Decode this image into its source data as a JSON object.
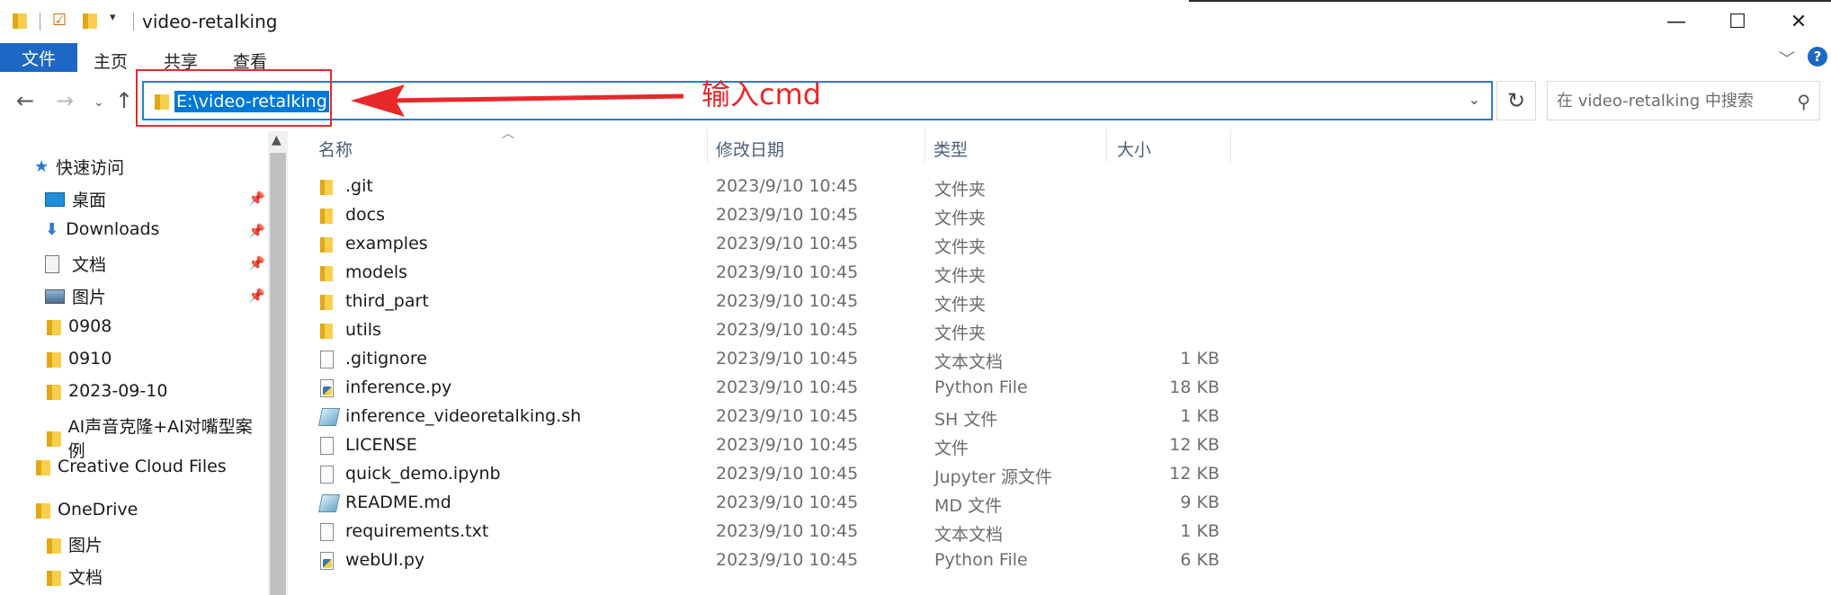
{
  "window": {
    "title": "video-retalking",
    "controls": {
      "minimize": "—",
      "maximize": "☐",
      "close": "✕"
    }
  },
  "ribbon": {
    "tabs": [
      "文件",
      "主页",
      "共享",
      "查看"
    ],
    "accent": "#1d68c4"
  },
  "address": {
    "path": "E:\\video-retalking",
    "search_placeholder": "在 video-retalking 中搜索"
  },
  "annotation": {
    "text": "输入cmd",
    "color": "#e8282b"
  },
  "nav": {
    "quick_access": "快速访问",
    "items": [
      {
        "label": "桌面",
        "icon": "desktop-icon",
        "pinned": true
      },
      {
        "label": "Downloads",
        "icon": "download-icon",
        "pinned": true
      },
      {
        "label": "文档",
        "icon": "document-icon",
        "pinned": true
      },
      {
        "label": "图片",
        "icon": "pictures-icon",
        "pinned": true
      },
      {
        "label": "0908",
        "icon": "folder-icon",
        "pinned": false
      },
      {
        "label": "0910",
        "icon": "folder-icon",
        "pinned": false
      },
      {
        "label": "2023-09-10",
        "icon": "folder-icon",
        "pinned": false
      },
      {
        "label": "AI声音克隆+AI对嘴型案例",
        "icon": "folder-icon",
        "pinned": false
      }
    ],
    "creative_cloud": "Creative Cloud Files",
    "onedrive": "OneDrive",
    "onedrive_items": [
      "图片",
      "文档"
    ]
  },
  "columns": {
    "name": "名称",
    "date": "修改日期",
    "type": "类型",
    "size": "大小"
  },
  "files": [
    {
      "name": ".git",
      "date": "2023/9/10 10:45",
      "type": "文件夹",
      "size": "",
      "kind": "folder"
    },
    {
      "name": "docs",
      "date": "2023/9/10 10:45",
      "type": "文件夹",
      "size": "",
      "kind": "folder"
    },
    {
      "name": "examples",
      "date": "2023/9/10 10:45",
      "type": "文件夹",
      "size": "",
      "kind": "folder"
    },
    {
      "name": "models",
      "date": "2023/9/10 10:45",
      "type": "文件夹",
      "size": "",
      "kind": "folder"
    },
    {
      "name": "third_part",
      "date": "2023/9/10 10:45",
      "type": "文件夹",
      "size": "",
      "kind": "folder"
    },
    {
      "name": "utils",
      "date": "2023/9/10 10:45",
      "type": "文件夹",
      "size": "",
      "kind": "folder"
    },
    {
      "name": ".gitignore",
      "date": "2023/9/10 10:45",
      "type": "文本文档",
      "size": "1 KB",
      "kind": "doc"
    },
    {
      "name": "inference.py",
      "date": "2023/9/10 10:45",
      "type": "Python File",
      "size": "18 KB",
      "kind": "py"
    },
    {
      "name": "inference_videoretalking.sh",
      "date": "2023/9/10 10:45",
      "type": "SH 文件",
      "size": "1 KB",
      "kind": "sh"
    },
    {
      "name": "LICENSE",
      "date": "2023/9/10 10:45",
      "type": "文件",
      "size": "12 KB",
      "kind": "doc"
    },
    {
      "name": "quick_demo.ipynb",
      "date": "2023/9/10 10:45",
      "type": "Jupyter 源文件",
      "size": "12 KB",
      "kind": "doc"
    },
    {
      "name": "README.md",
      "date": "2023/9/10 10:45",
      "type": "MD 文件",
      "size": "9 KB",
      "kind": "sh"
    },
    {
      "name": "requirements.txt",
      "date": "2023/9/10 10:45",
      "type": "文本文档",
      "size": "1 KB",
      "kind": "doc"
    },
    {
      "name": "webUI.py",
      "date": "2023/9/10 10:45",
      "type": "Python File",
      "size": "6 KB",
      "kind": "py"
    }
  ]
}
